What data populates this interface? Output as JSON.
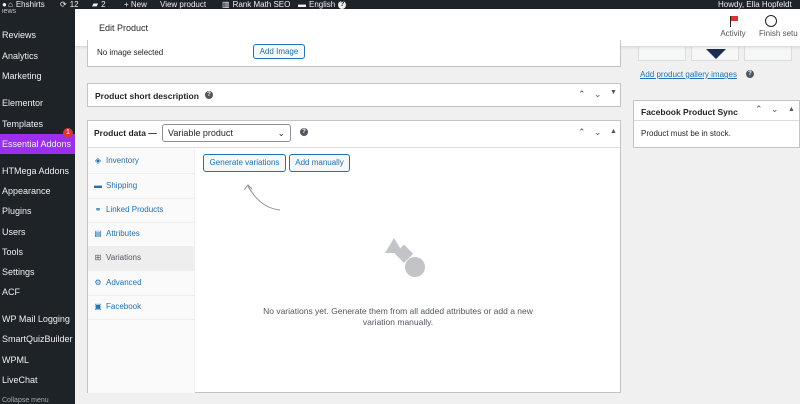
{
  "admin_bar": {
    "site_name": "Ehshirts",
    "updates_count": "12",
    "comments_count": "2",
    "new_label": "+ New",
    "view_product": "View product",
    "rank_math": "Rank Math SEO",
    "language": "English",
    "greeting": "Howdy, Ella Hopfeldt"
  },
  "sidebar": {
    "cut_top": "iews",
    "items": [
      {
        "label": "Reviews"
      },
      {
        "label": "Analytics"
      },
      {
        "label": "Marketing"
      },
      {
        "label": "Elementor"
      },
      {
        "label": "Templates"
      },
      {
        "label": "Essential Addons",
        "badge": "1"
      },
      {
        "label": "HTMega Addons"
      },
      {
        "label": "Appearance"
      },
      {
        "label": "Plugins"
      },
      {
        "label": "Users"
      },
      {
        "label": "Tools"
      },
      {
        "label": "Settings"
      },
      {
        "label": "ACF"
      },
      {
        "label": "WP Mail Logging"
      },
      {
        "label": "SmartQuizBuilder"
      },
      {
        "label": "WPML"
      },
      {
        "label": "LiveChat"
      }
    ],
    "collapse": "Collapse menu"
  },
  "header": {
    "title": "Edit Product",
    "activity": "Activity",
    "finish_setup": "Finish setu"
  },
  "product_image": {
    "no_image": "No image selected",
    "add_image": "Add Image"
  },
  "short_description": {
    "title": "Product short description"
  },
  "product_data": {
    "title": "Product data —",
    "type_selected": "Variable product",
    "tabs": [
      {
        "label": "Inventory",
        "icon": "inventory-icon"
      },
      {
        "label": "Shipping",
        "icon": "truck-icon"
      },
      {
        "label": "Linked Products",
        "icon": "link-icon"
      },
      {
        "label": "Attributes",
        "icon": "list-icon"
      },
      {
        "label": "Variations",
        "icon": "grid-icon"
      },
      {
        "label": "Advanced",
        "icon": "gear-icon"
      },
      {
        "label": "Facebook",
        "icon": "facebook-icon"
      }
    ],
    "generate_variations": "Generate variations",
    "add_manually": "Add manually",
    "empty_message": "No variations yet. Generate them from all added attributes or add a new variation manually."
  },
  "gallery": {
    "link": "Add product gallery images"
  },
  "facebook_sync": {
    "title": "Facebook Product Sync",
    "message": "Product must be in stock."
  }
}
